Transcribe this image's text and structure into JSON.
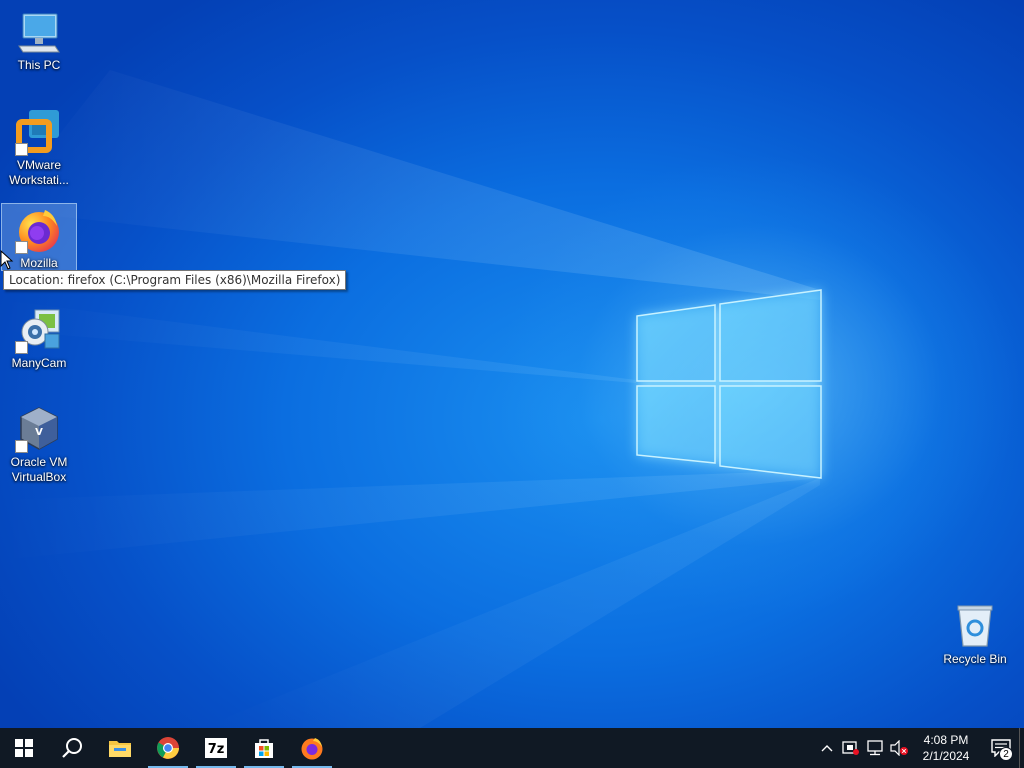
{
  "desktop": {
    "icons": [
      {
        "label": "This PC",
        "icon": "this-pc-icon"
      },
      {
        "label": "VMware\nWorkstati...",
        "icon": "vmware-workstation-icon"
      },
      {
        "label": "Mozilla",
        "icon": "firefox-icon"
      },
      {
        "label": "ManyCam",
        "icon": "manycam-icon"
      },
      {
        "label": "Oracle VM\nVirtualBox",
        "icon": "virtualbox-icon"
      },
      {
        "label": "Recycle Bin",
        "icon": "recycle-bin-icon"
      }
    ],
    "tooltip": "Location: firefox (C:\\Program Files (x86)\\Mozilla Firefox)"
  },
  "taskbar": {
    "start": "windows-start-icon",
    "search": "search-icon",
    "pinned": [
      "file-explorer-icon",
      "chrome-icon",
      "7zip-icon",
      "microsoft-store-icon",
      "firefox-icon"
    ],
    "tray": {
      "chevron": "show-hidden-icons-chevron",
      "icons": [
        "vmware-tray-icon",
        "network-icon",
        "volume-muted-icon"
      ],
      "time": "4:08 PM",
      "date": "2/1/2024",
      "notification_count": "2"
    }
  },
  "colors": {
    "taskbar": "#101924",
    "desktop_accent": "#0b6ee0"
  }
}
